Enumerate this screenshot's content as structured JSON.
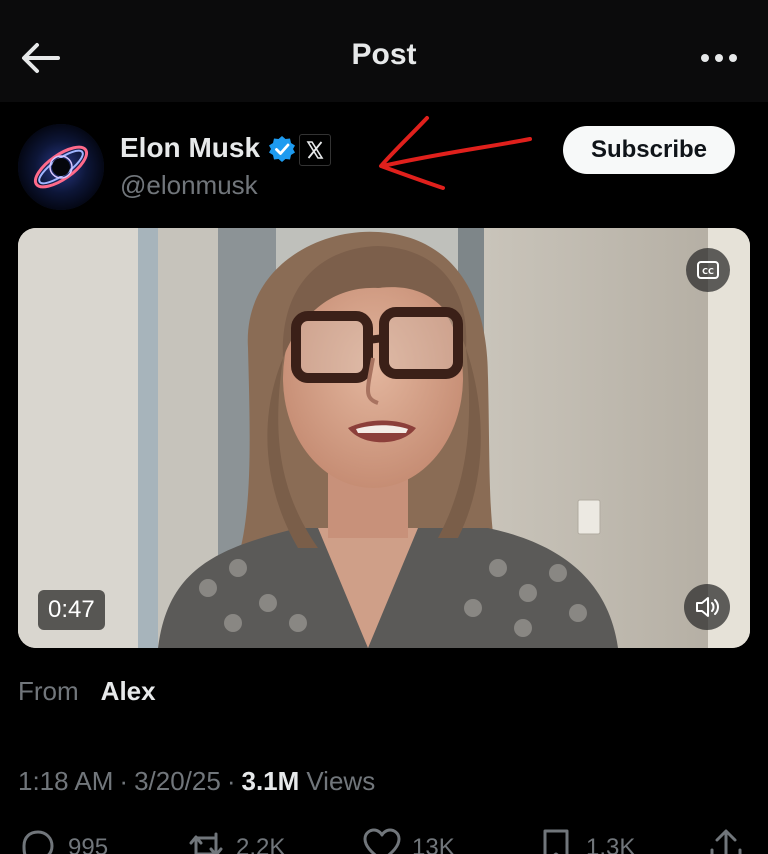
{
  "header": {
    "title": "Post",
    "back_icon": "arrow-left-icon",
    "more_icon": "more-horizontal-icon"
  },
  "author": {
    "name": "Elon Musk",
    "handle": "@elonmusk",
    "subscribe_label": "Subscribe",
    "verified_color": "#1d9bf0",
    "affiliation_badge": "x-logo-icon"
  },
  "video": {
    "duration": "0:47",
    "cc_icon": "captions-icon",
    "mute_icon": "volume-icon"
  },
  "source": {
    "label": "From",
    "name": "Alex"
  },
  "meta": {
    "time": "1:18 AM",
    "date": "3/20/25",
    "views_count": "3.1M",
    "views_label": "Views"
  },
  "actions": {
    "replies": "995",
    "reposts": "2.2K",
    "likes": "13K",
    "bookmarks": "1.3K"
  },
  "colors": {
    "background": "#000000",
    "topbar": "#0b0b0c",
    "text_primary": "#e7e9ea",
    "text_secondary": "#71767b",
    "annotation": "#e0201c"
  }
}
